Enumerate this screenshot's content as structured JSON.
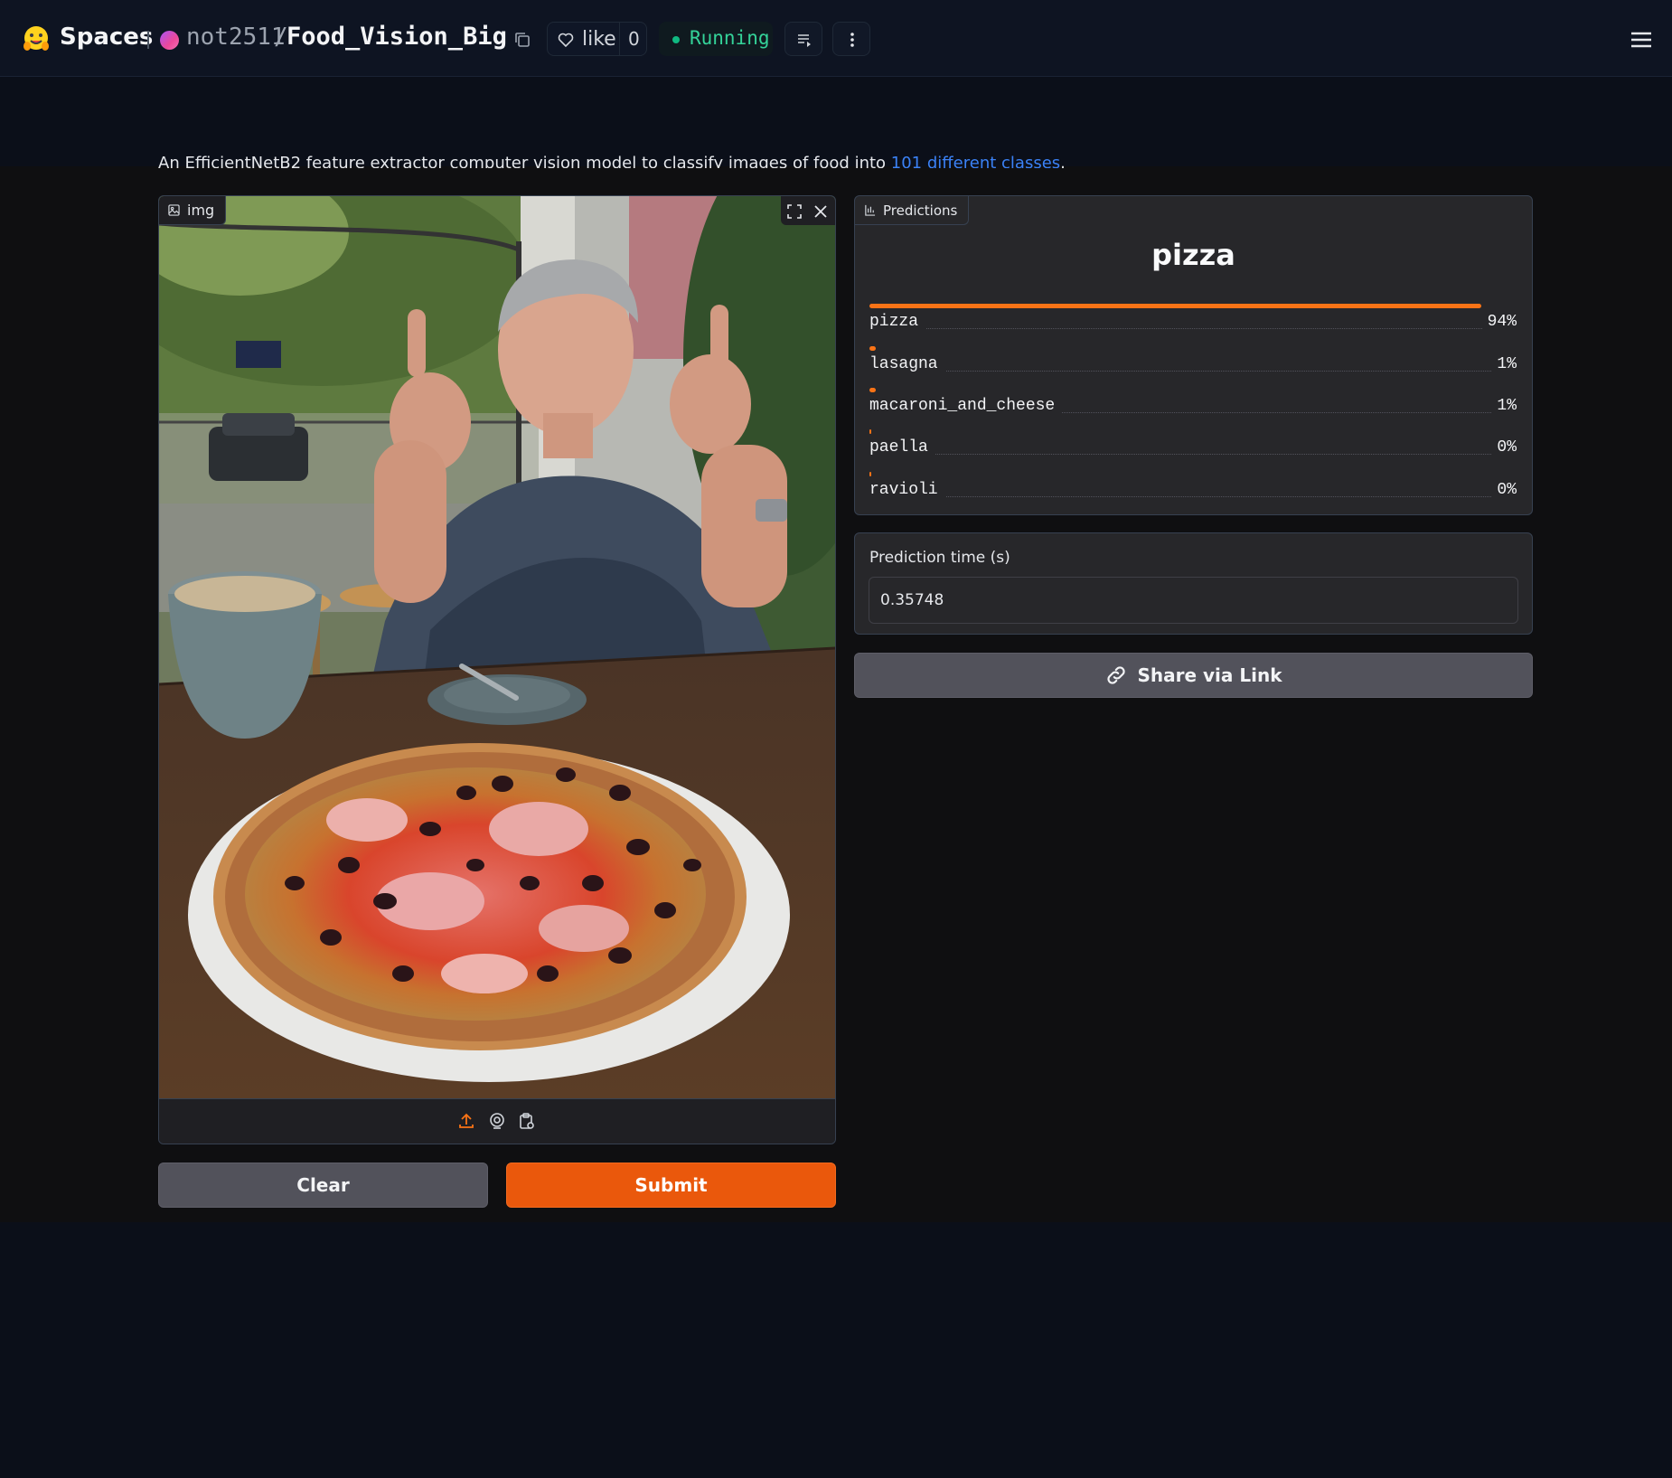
{
  "header": {
    "brand": "Spaces",
    "owner": "not2511",
    "separator": "/",
    "repo": "Food_Vision_Big",
    "like_label": "like",
    "like_count": "0",
    "status": "Running",
    "colors": {
      "status_green": "#34d399",
      "accent_orange": "#f97316"
    }
  },
  "description": {
    "text": "An EfficientNetB2 feature extractor computer vision model to classify images of food into ",
    "link": "101 different classes",
    "suffix": "."
  },
  "image_input": {
    "label": "img",
    "icons": [
      "image-icon",
      "fullscreen-icon",
      "close-icon",
      "upload-icon",
      "webcam-icon",
      "clipboard-icon"
    ]
  },
  "buttons": {
    "clear": "Clear",
    "submit": "Submit",
    "share": "Share via Link"
  },
  "predictions": {
    "tab_label": "Predictions",
    "top_label": "pizza",
    "items": [
      {
        "label": "pizza",
        "pct": "94%",
        "value": 0.94
      },
      {
        "label": "lasagna",
        "pct": "1%",
        "value": 0.01
      },
      {
        "label": "macaroni_and_cheese",
        "pct": "1%",
        "value": 0.01
      },
      {
        "label": "paella",
        "pct": "0%",
        "value": 0.0
      },
      {
        "label": "ravioli",
        "pct": "0%",
        "value": 0.0
      }
    ]
  },
  "prediction_time": {
    "label": "Prediction time (s)",
    "value": "0.35748"
  }
}
